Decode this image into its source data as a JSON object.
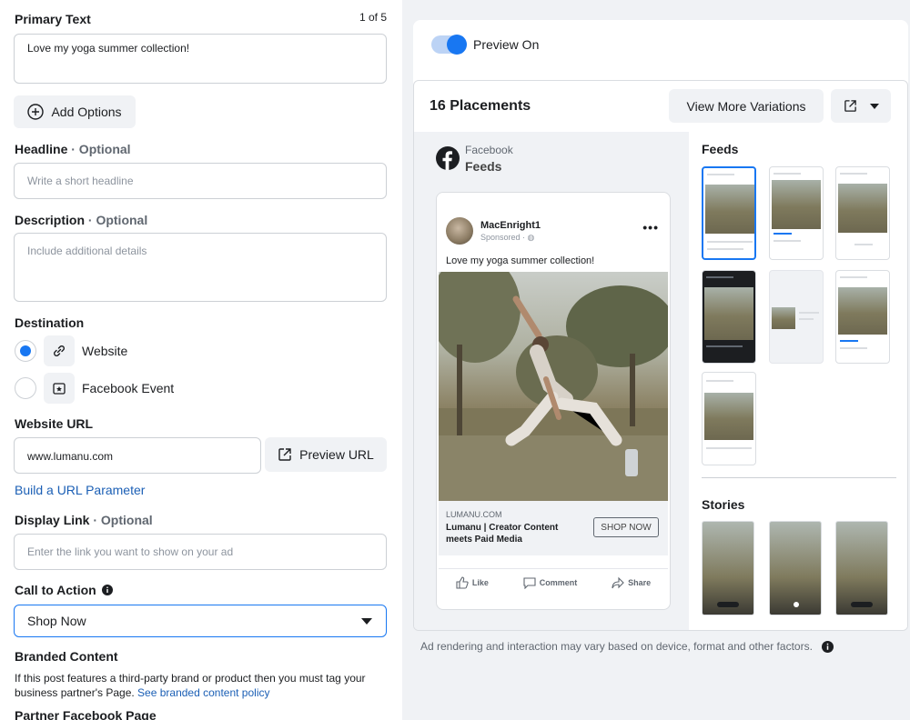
{
  "primary_text": {
    "label": "Primary Text",
    "counter": "1 of 5",
    "value": "Love my yoga summer collection!"
  },
  "add_options": {
    "label": "Add Options"
  },
  "headline": {
    "label": "Headline",
    "optional": "· Optional",
    "placeholder": "Write a short headline"
  },
  "description": {
    "label": "Description",
    "optional": "· Optional",
    "placeholder": "Include additional details"
  },
  "destination": {
    "label": "Destination",
    "website": "Website",
    "facebook_event": "Facebook Event",
    "selected": "website"
  },
  "website_url": {
    "label": "Website URL",
    "value": "www.lumanu.com",
    "preview_button": "Preview URL",
    "build_param": "Build a URL Parameter"
  },
  "display_link": {
    "label": "Display Link",
    "optional": "· Optional",
    "placeholder": "Enter the link you want to show on your ad"
  },
  "cta": {
    "label": "Call to Action",
    "value": "Shop Now"
  },
  "branded": {
    "label": "Branded Content",
    "text": "If this post features a third-party brand or product then you must tag your business partner's Page.",
    "link": "See branded content policy"
  },
  "partner": {
    "label": "Partner Facebook Page"
  },
  "preview": {
    "toggle_label": "Preview On",
    "placements_title": "16 Placements",
    "view_more": "View More Variations",
    "platform": "Facebook",
    "placement": "Feeds",
    "feeds_heading": "Feeds",
    "stories_heading": "Stories",
    "footer_note": "Ad rendering and interaction may vary based on device, format and other factors."
  },
  "post": {
    "author": "MacEnright1",
    "sponsored": "Sponsored",
    "text": "Love my yoga summer collection!",
    "domain": "LUMANU.COM",
    "link_title": "Lumanu | Creator Content meets Paid Media",
    "cta": "SHOP NOW",
    "like": "Like",
    "comment": "Comment",
    "share": "Share"
  },
  "colors": {
    "accent": "#1877f2",
    "link": "#1b5fb5",
    "bg": "#f0f2f5"
  }
}
